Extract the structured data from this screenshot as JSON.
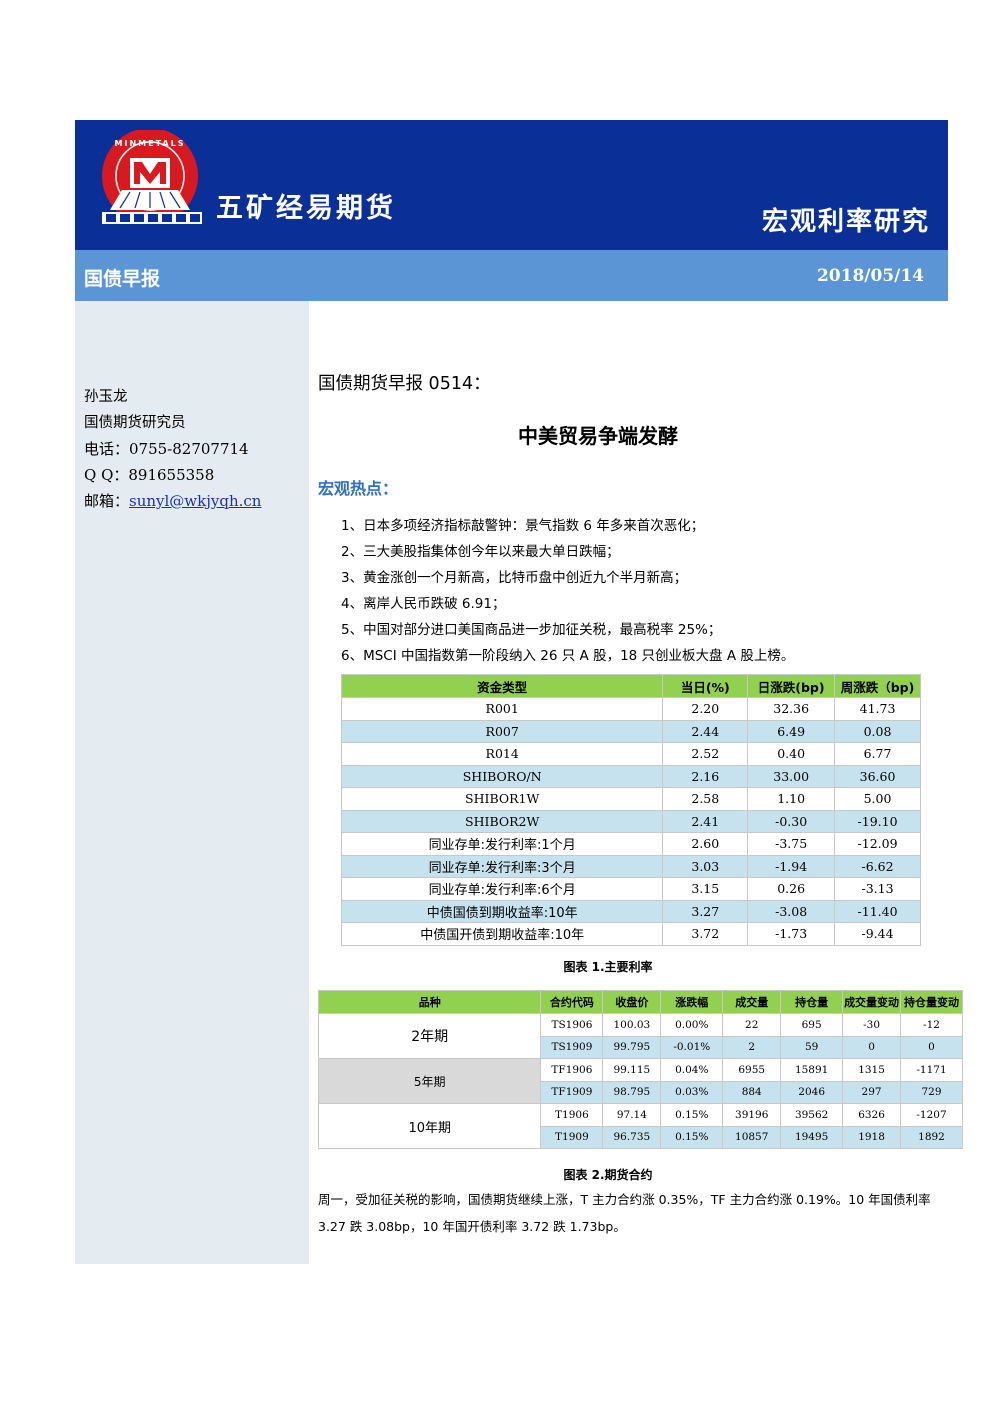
{
  "header": {
    "company": "五矿经易期货",
    "title": "宏观利率研究",
    "logo_text": "MINMETALS"
  },
  "subbar": {
    "left": "国债早报",
    "date": "2018/05/14"
  },
  "author": {
    "name": "孙玉龙",
    "role": "国债期货研究员",
    "phone": "电话：0755-82707714",
    "qq": "Q Q：891655358",
    "email_label": "邮箱：",
    "email": "sunyl@wkjyqh.cn"
  },
  "doc": {
    "subtitle": "国债期货早报 0514：",
    "title": "中美贸易争端发酵",
    "section": "宏观热点：",
    "bullets": [
      "1、日本多项经济指标敲警钟：景气指数 6 年多来首次恶化；",
      "2、三大美股指集体创今年以来最大单日跌幅；",
      "3、黄金涨创一个月新高，比特币盘中创近九个半月新高；",
      "4、离岸人民币跌破 6.91；",
      "5、中国对部分进口美国商品进一步加征关税，最高税率 25%；",
      "6、MSCI 中国指数第一阶段纳入 26 只 A 股，18 只创业板大盘 A 股上榜。"
    ]
  },
  "rates_table": {
    "headers": [
      "资金类型",
      "当日(%)",
      "日涨跌(bp)",
      "周涨跌（bp)"
    ],
    "rows": [
      {
        "name": "R001",
        "day": "2.20",
        "dchg": "32.36",
        "wchg": "41.73"
      },
      {
        "name": "R007",
        "day": "2.44",
        "dchg": "6.49",
        "wchg": "0.08"
      },
      {
        "name": "R014",
        "day": "2.52",
        "dchg": "0.40",
        "wchg": "6.77"
      },
      {
        "name": "SHIBORO/N",
        "day": "2.16",
        "dchg": "33.00",
        "wchg": "36.60"
      },
      {
        "name": "SHIBOR1W",
        "day": "2.58",
        "dchg": "1.10",
        "wchg": "5.00"
      },
      {
        "name": "SHIBOR2W",
        "day": "2.41",
        "dchg": "-0.30",
        "wchg": "-19.10"
      },
      {
        "name": "同业存单:发行利率:1个月",
        "day": "2.60",
        "dchg": "-3.75",
        "wchg": "-12.09"
      },
      {
        "name": "同业存单:发行利率:3个月",
        "day": "3.03",
        "dchg": "-1.94",
        "wchg": "-6.62"
      },
      {
        "name": "同业存单:发行利率:6个月",
        "day": "3.15",
        "dchg": "0.26",
        "wchg": "-3.13"
      },
      {
        "name": "中债国债到期收益率:10年",
        "day": "3.27",
        "dchg": "-3.08",
        "wchg": "-11.40"
      },
      {
        "name": "中债国开债到期收益率:10年",
        "day": "3.72",
        "dchg": "-1.73",
        "wchg": "-9.44"
      }
    ],
    "caption": "图表 1.主要利率"
  },
  "futures_table": {
    "headers": [
      "品种",
      "合约代码",
      "收盘价",
      "涨跌幅",
      "成交量",
      "持仓量",
      "成交量变动",
      "持仓量变动"
    ],
    "groups": [
      {
        "label": "2年期",
        "rows": [
          [
            "TS1906",
            "100.03",
            "0.00%",
            "22",
            "695",
            "-30",
            "-12"
          ],
          [
            "TS1909",
            "99.795",
            "-0.01%",
            "2",
            "59",
            "0",
            "0"
          ]
        ]
      },
      {
        "label": "5年期",
        "rows": [
          [
            "TF1906",
            "99.115",
            "0.04%",
            "6955",
            "15891",
            "1315",
            "-1171"
          ],
          [
            "TF1909",
            "98.795",
            "0.03%",
            "884",
            "2046",
            "297",
            "729"
          ]
        ]
      },
      {
        "label": "10年期",
        "rows": [
          [
            "T1906",
            "97.14",
            "0.15%",
            "39196",
            "39562",
            "6326",
            "-1207"
          ],
          [
            "T1909",
            "96.735",
            "0.15%",
            "10857",
            "19495",
            "1918",
            "1892"
          ]
        ]
      }
    ],
    "caption": "图表 2.期货合约"
  },
  "commentary": "周一，受加征关税的影响，国债期货继续上涨，T 主力合约涨 0.35%，TF 主力合约涨 0.19%。10 年国债利率 3.27 跌 3.08bp，10 年国开债利率 3.72 跌 1.73bp。"
}
